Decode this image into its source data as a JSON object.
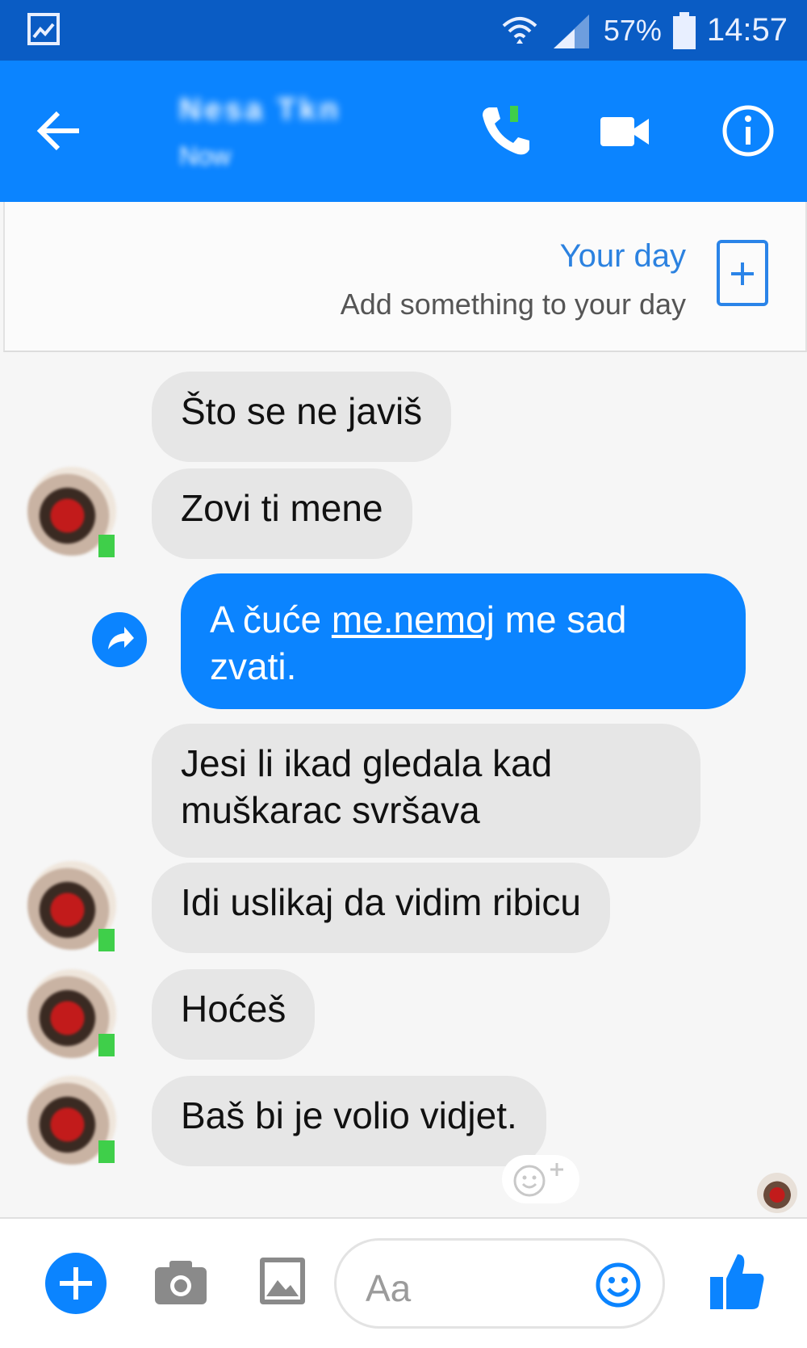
{
  "status_bar": {
    "battery_percent": "57%",
    "time": "14:57",
    "icons": [
      "gallery-icon",
      "wifi-icon",
      "signal-icon",
      "battery-icon"
    ]
  },
  "header": {
    "contact_name": "Nesa Tkn",
    "contact_status": "Now",
    "actions": [
      "back-arrow-icon",
      "phone-icon",
      "video-camera-icon",
      "info-icon"
    ]
  },
  "your_day": {
    "title": "Your day",
    "subtitle": "Add something to your day"
  },
  "messages": [
    {
      "from": "them",
      "text": "Što se ne javiš"
    },
    {
      "from": "them",
      "text": "Zovi ti mene"
    },
    {
      "from": "me",
      "text_before": "A čuće ",
      "link": "me.nemoj",
      "text_after": " me sad zvati."
    },
    {
      "from": "them",
      "text": "Jesi li ikad gledala kad muškarac svršava"
    },
    {
      "from": "them",
      "text": "Idi uslikaj da vidim ribicu"
    },
    {
      "from": "them",
      "text": "Hoćeš"
    },
    {
      "from": "them",
      "text": "Baš bi je volio vidjet."
    }
  ],
  "composer": {
    "placeholder": "Aa",
    "icons": [
      "plus-icon",
      "camera-icon",
      "image-icon",
      "emoji-icon",
      "thumbs-up-icon"
    ]
  },
  "colors": {
    "status_bar": "#0a5cc4",
    "header": "#0b84ff",
    "outgoing_bubble": "#0b84ff",
    "incoming_bubble": "#e6e6e6",
    "online": "#3fcf4a"
  }
}
